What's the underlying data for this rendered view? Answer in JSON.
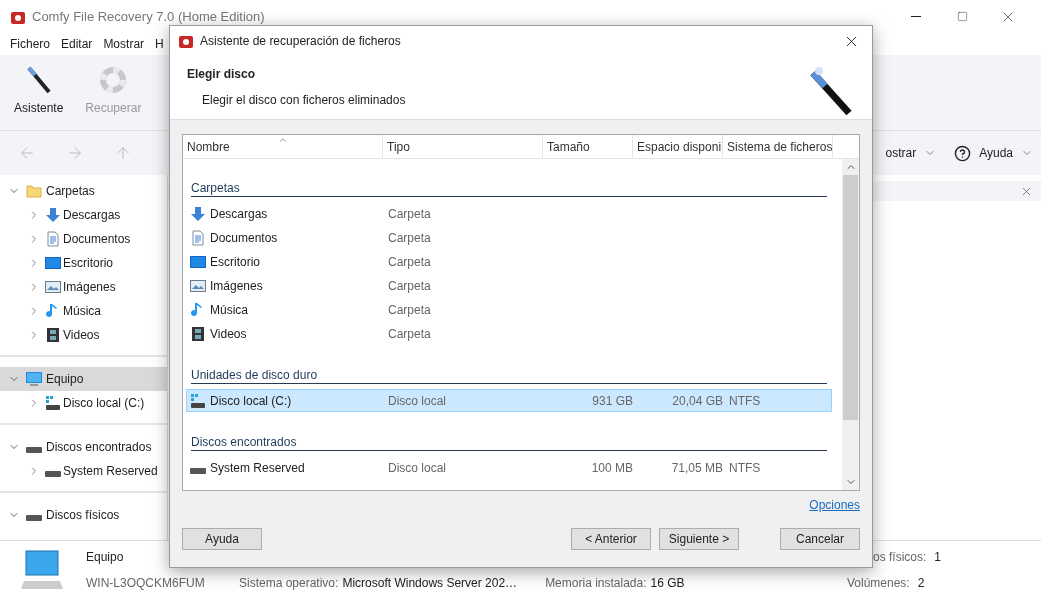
{
  "window": {
    "title": "Comfy File Recovery 7.0 (Home Edition)"
  },
  "menu": [
    "Fichero",
    "Editar",
    "Mostrar",
    "H"
  ],
  "toolbar": [
    {
      "label": "Asistente",
      "kind": "wand",
      "disabled": false
    },
    {
      "label": "Recuperar",
      "kind": "lifebuoy",
      "disabled": true
    }
  ],
  "view_toolbar": {
    "show_label": "ostrar",
    "help_label": "Ayuda"
  },
  "sidebar": [
    {
      "label": "Carpetas",
      "kind": "folder",
      "expanded": true,
      "selected": false,
      "children": [
        {
          "label": "Descargas",
          "kind": "download",
          "selected": false
        },
        {
          "label": "Documentos",
          "kind": "document",
          "selected": false
        },
        {
          "label": "Escritorio",
          "kind": "desktop",
          "selected": false
        },
        {
          "label": "Imágenes",
          "kind": "image",
          "selected": false
        },
        {
          "label": "Música",
          "kind": "music",
          "selected": false
        },
        {
          "label": "Videos",
          "kind": "video",
          "selected": false
        }
      ]
    },
    {
      "label": "Equipo",
      "kind": "computer",
      "expanded": true,
      "selected": true,
      "children": [
        {
          "label": "Disco local (C:)",
          "kind": "system-drive",
          "selected": false
        }
      ]
    },
    {
      "label": "Discos encontrados",
      "kind": "drive",
      "expanded": true,
      "selected": false,
      "children": [
        {
          "label": "System Reserved",
          "kind": "drive",
          "selected": false
        }
      ]
    },
    {
      "label": "Discos físicos",
      "kind": "drive",
      "expanded": true,
      "selected": false
    }
  ],
  "status_bar": {
    "name": "Equipo",
    "computer": "WIN-L3OQCKM6FUM",
    "fields": [
      {
        "label": "Sistema operativo:",
        "value": "Microsoft Windows Server 202…"
      },
      {
        "label": "Memoria instalada:",
        "value": "16 GB"
      }
    ],
    "right": [
      {
        "label": "os físicos:",
        "value": "1"
      },
      {
        "label": "Volúmenes:",
        "value": "2"
      }
    ]
  },
  "dialog": {
    "title": "Asistente de recuperación de ficheros",
    "heading": "Elegir disco",
    "subtitle": "Elegir el disco con ficheros eliminados",
    "columns": [
      {
        "label": "Nombre",
        "sorted": true
      },
      {
        "label": "Tipo",
        "sorted": false
      },
      {
        "label": "Tamaño",
        "sorted": false
      },
      {
        "label": "Espacio disponi",
        "sorted": false
      },
      {
        "label": "Sistema de ficheros",
        "sorted": false
      }
    ],
    "groups": [
      {
        "label": "Carpetas",
        "rows": [
          {
            "name": "Descargas",
            "kind": "download",
            "type": "Carpeta",
            "selected": false
          },
          {
            "name": "Documentos",
            "kind": "document",
            "type": "Carpeta",
            "selected": false
          },
          {
            "name": "Escritorio",
            "kind": "desktop",
            "type": "Carpeta",
            "selected": false
          },
          {
            "name": "Imágenes",
            "kind": "image",
            "type": "Carpeta",
            "selected": false
          },
          {
            "name": "Música",
            "kind": "music",
            "type": "Carpeta",
            "selected": false
          },
          {
            "name": "Videos",
            "kind": "video",
            "type": "Carpeta",
            "selected": false
          }
        ]
      },
      {
        "label": "Unidades de disco duro",
        "rows": [
          {
            "name": "Disco local (C:)",
            "kind": "system-drive",
            "type": "Disco local",
            "size": "931 GB",
            "free": "20,04 GB",
            "fs": "NTFS",
            "selected": true
          }
        ]
      },
      {
        "label": "Discos encontrados",
        "rows": [
          {
            "name": "System Reserved",
            "kind": "drive",
            "type": "Disco local",
            "size": "100 MB",
            "free": "71,05 MB",
            "fs": "NTFS",
            "selected": false
          }
        ]
      }
    ],
    "options_link": "Opciones",
    "buttons": [
      {
        "label": "Ayuda",
        "kind": "help"
      },
      {
        "label": "< Anterior",
        "kind": "nav"
      },
      {
        "label": "Siguiente >",
        "kind": "nav"
      },
      {
        "label": "Cancelar",
        "kind": "cancel"
      }
    ]
  }
}
